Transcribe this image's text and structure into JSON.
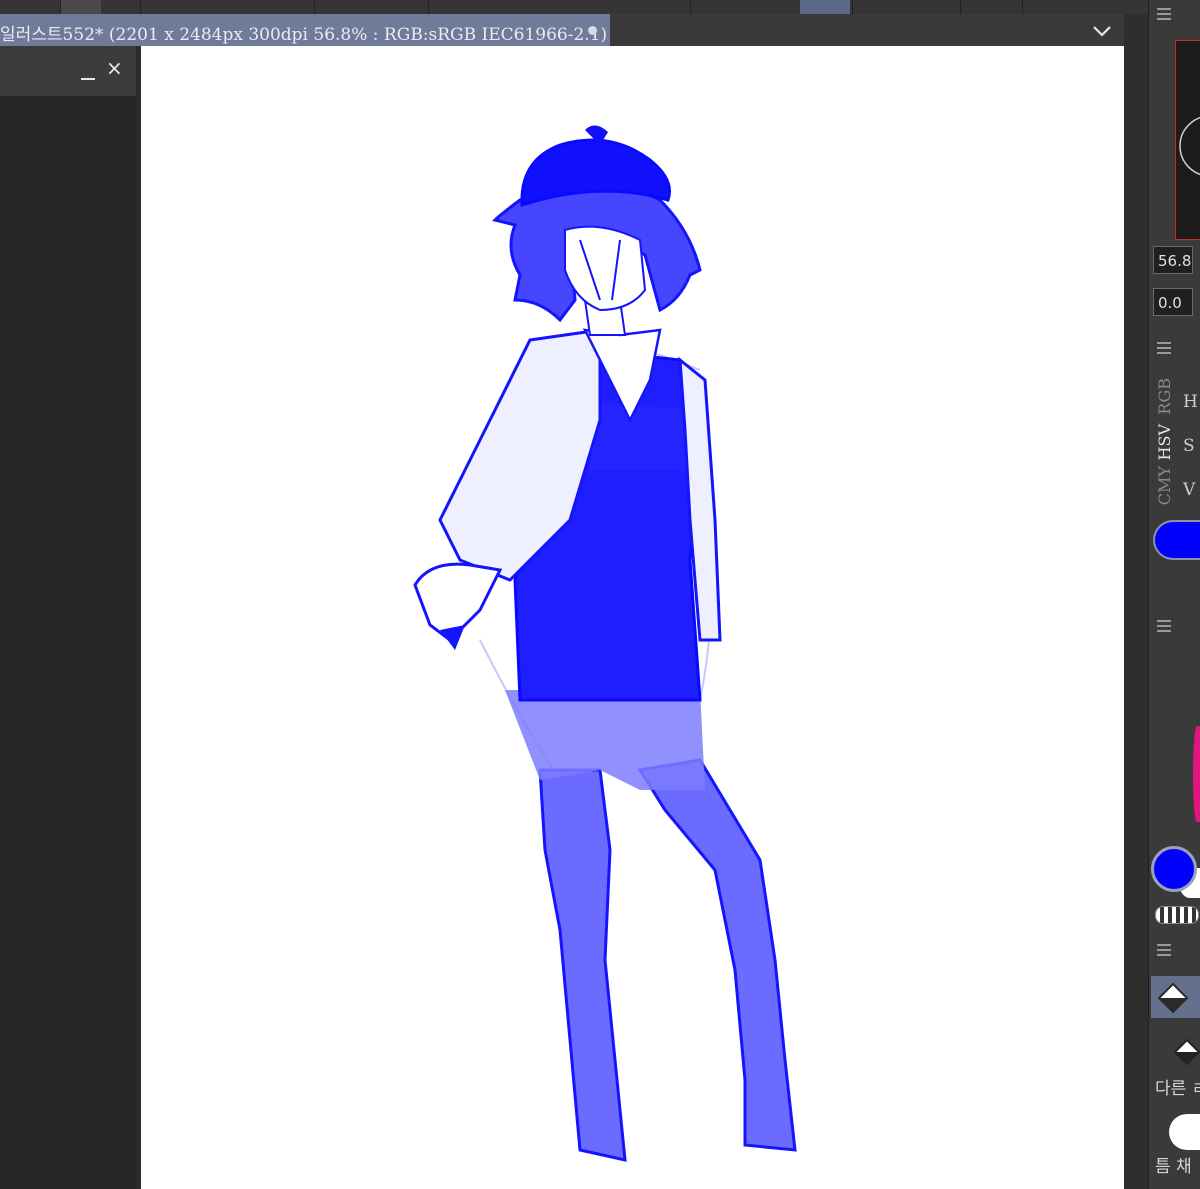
{
  "document": {
    "tab_title": "일러스트552* (2201 x 2484px 300dpi 56.8% : RGB:sRGB IEC61966-2.1)"
  },
  "left_panel": {
    "close_glyph": "×"
  },
  "navigator": {
    "zoom_value": "56.8",
    "angle_value": "0.0"
  },
  "color_slider": {
    "tabs": [
      "RGB",
      "HSV",
      "CMY"
    ],
    "active_tab": "HSV",
    "channels": [
      "H",
      "S",
      "V"
    ]
  },
  "tool_panel": {
    "label_1": "다른 ㄹ",
    "label_2": "틈 채"
  },
  "colors": {
    "main": "#0000ff",
    "sub": "#ffffff",
    "ui_bg": "#2b2b2b",
    "tab_active": "#6f7b98",
    "sketch": "#1414ff"
  },
  "icons": {
    "tab_overflow": "chevron-down-icon",
    "minimize": "minimize-icon",
    "close": "close-icon",
    "menu": "hamburger-menu-icon",
    "fill": "paint-bucket-icon"
  }
}
